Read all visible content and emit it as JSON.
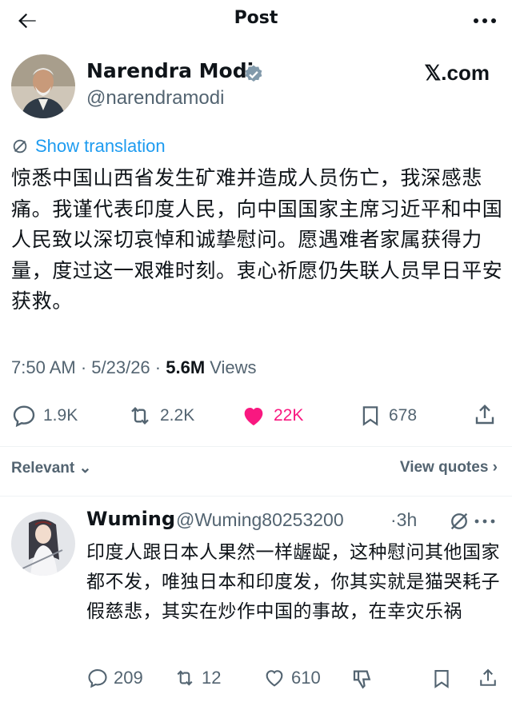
{
  "header": {
    "title": "Post",
    "back_icon": "arrow-left-icon",
    "more_icon": "more-horizontal-icon"
  },
  "post": {
    "author_name": "Narendra Modi",
    "handle": "@narendramodi",
    "watermark": "𝕏.com",
    "show_translation": "Show translation",
    "text": "惊悉中国山西省发生矿难并造成人员伤亡，我深感悲痛。我谨代表印度人民，向中国国家主席习近平和中国人民致以深切哀悼和诚挚慰问。愿遇难者家属获得力量，度过这一艰难时刻。衷心祈愿仍失联人员早日平安获救。",
    "time": "7:50 AM · 5/23/26 · ",
    "views_count": "5.6M",
    "views_label": " Views",
    "replies": "1.9K",
    "reposts": "2.2K",
    "likes": "22K",
    "bookmarks": "678"
  },
  "sort": {
    "relevant_label": "Relevant",
    "view_quotes_label": "View quotes"
  },
  "reply": {
    "name": "Wuming",
    "handle": "@Wuming80253200",
    "time": "·3h",
    "text": "印度人跟日本人果然一样龌龊，这种慰问其他国家都不发，唯独日本和印度发，你其实就是猫哭耗子假慈悲，其实在炒作中国的事故，在幸灾乐祸",
    "replies": "209",
    "reposts": "12",
    "likes": "610"
  },
  "colors": {
    "accent": "#1d9bf0",
    "like": "#f91880",
    "muted": "#536471",
    "text": "#0f1419"
  }
}
